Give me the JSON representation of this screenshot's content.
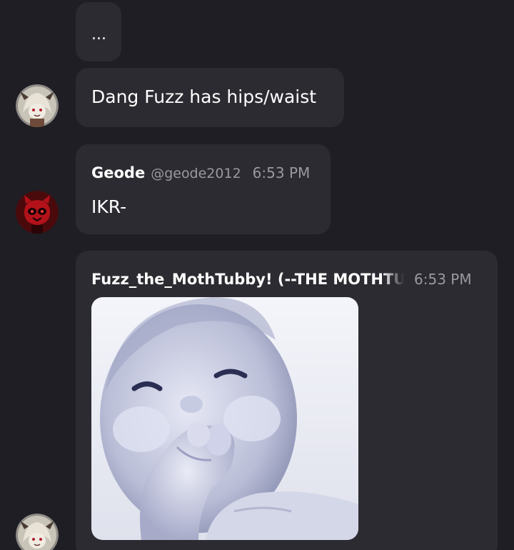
{
  "messages": [
    {
      "text": "..."
    },
    {
      "text": "Dang Fuzz has hips/waist"
    },
    {
      "author": "Geode",
      "handle": "@geode2012",
      "time": "6:53 PM",
      "text": "IKR-"
    },
    {
      "author": "Fuzz_the_MothTubby! (--THE MOTHTUBBY--)",
      "time": "6:53 PM",
      "attachment_icon": "baby-photo-image"
    }
  ],
  "colors": {
    "background": "#1f1e24",
    "bubble": "#2c2b31",
    "muted_text": "#9a99a1",
    "geode_avatar_red": "#b3121a"
  }
}
